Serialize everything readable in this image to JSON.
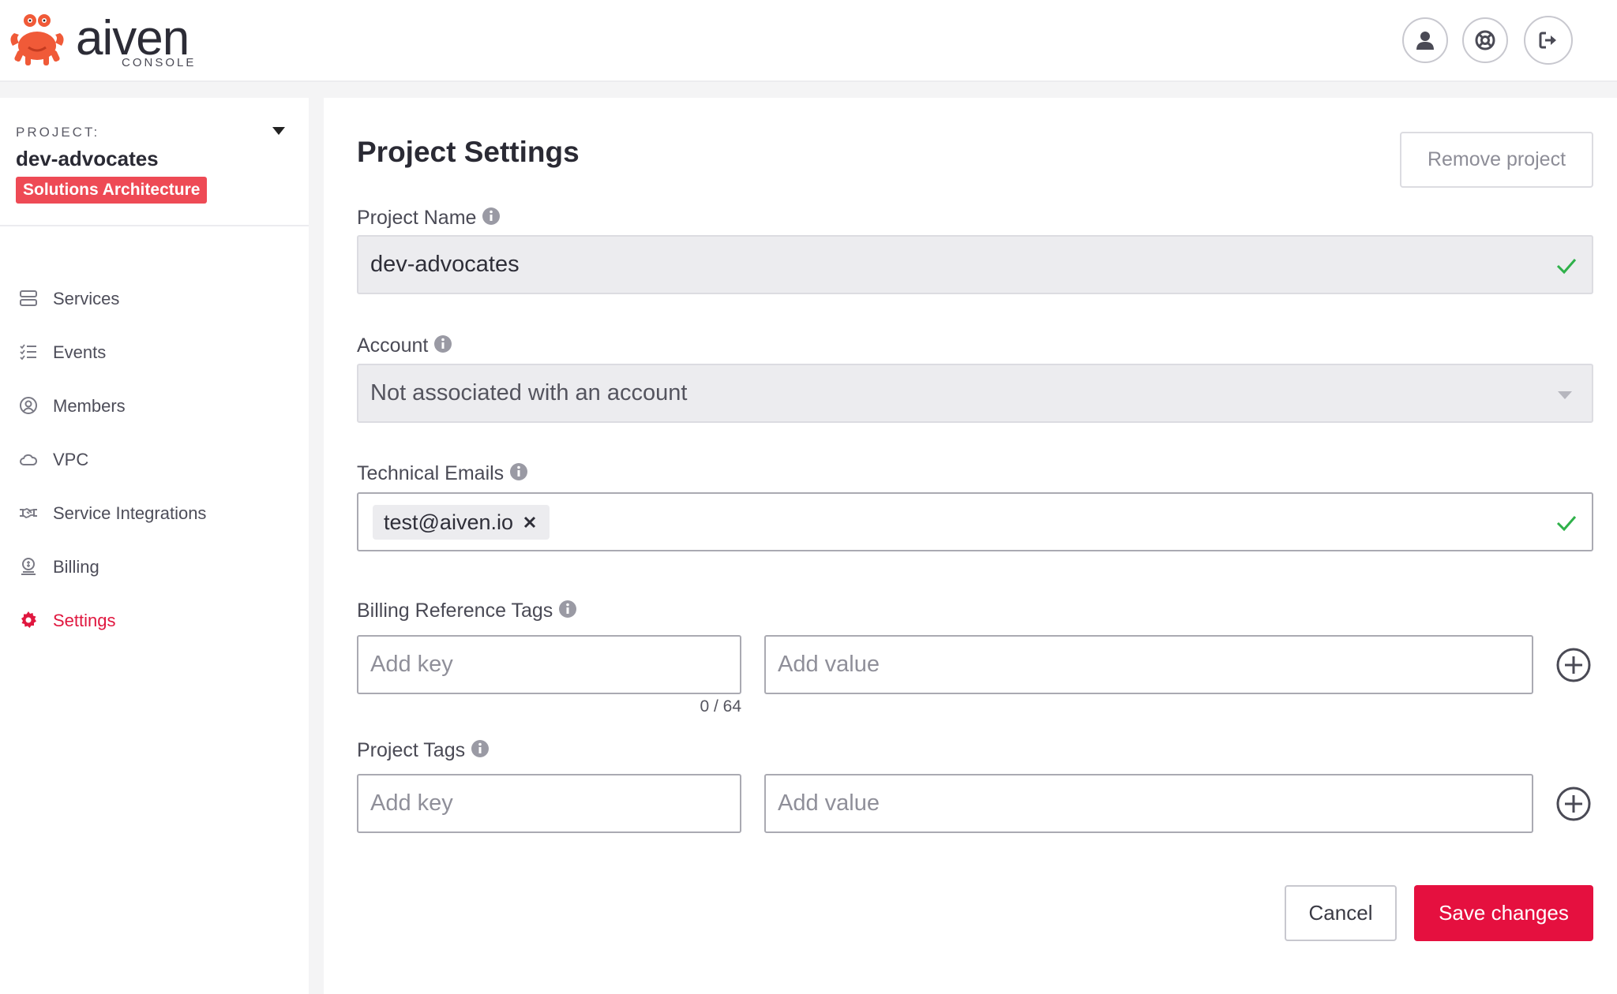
{
  "brand": {
    "name": "aiven",
    "sub": "CONSOLE"
  },
  "header": {
    "icons": [
      "user-icon",
      "lifebuoy-icon",
      "logout-icon"
    ]
  },
  "sidebar": {
    "project_label": "PROJECT:",
    "project_name": "dev-advocates",
    "project_badge": "Solutions Architecture",
    "items": [
      {
        "label": "Services",
        "icon": "services-icon"
      },
      {
        "label": "Events",
        "icon": "events-icon"
      },
      {
        "label": "Members",
        "icon": "members-icon"
      },
      {
        "label": "VPC",
        "icon": "cloud-icon"
      },
      {
        "label": "Service Integrations",
        "icon": "handshake-icon"
      },
      {
        "label": "Billing",
        "icon": "billing-icon"
      },
      {
        "label": "Settings",
        "icon": "gear-icon",
        "active": true
      }
    ]
  },
  "main": {
    "title": "Project Settings",
    "remove_label": "Remove project",
    "project_name": {
      "label": "Project Name",
      "value": "dev-advocates"
    },
    "account": {
      "label": "Account",
      "value": "Not associated with an account"
    },
    "technical_emails": {
      "label": "Technical Emails",
      "emails": [
        "test@aiven.io"
      ]
    },
    "billing_tags": {
      "label": "Billing Reference Tags",
      "key_placeholder": "Add key",
      "value_placeholder": "Add value",
      "counter": "0 / 64"
    },
    "project_tags": {
      "label": "Project Tags",
      "key_placeholder": "Add key",
      "value_placeholder": "Add value"
    },
    "cancel_label": "Cancel",
    "save_label": "Save changes"
  },
  "colors": {
    "accent": "#e5103f",
    "badge": "#ee4a55",
    "success": "#2fb14a"
  }
}
